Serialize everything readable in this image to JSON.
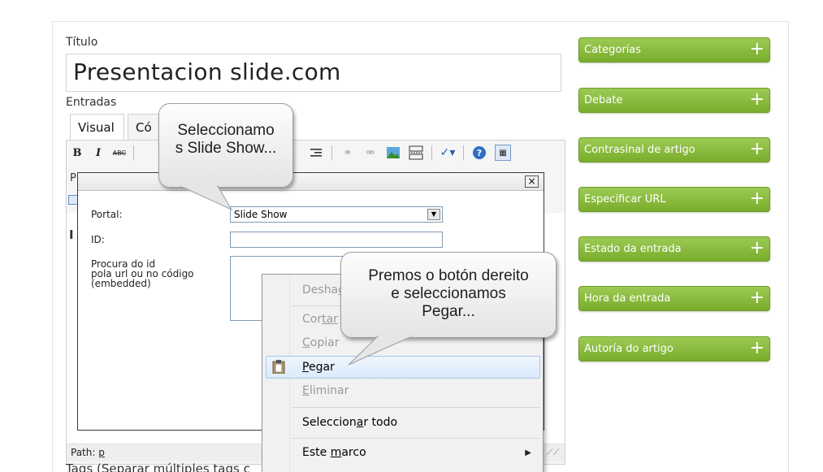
{
  "post": {
    "title_label": "Título",
    "title_value": "Presentacion slide.com",
    "entries_label": "Entradas",
    "tab_visual": "Visual",
    "tab_code": "Có",
    "path_label": "Path:",
    "path_value": "p",
    "tags_label": "Tags (Separar múltiples tags c"
  },
  "toolbar": {
    "bold": "B",
    "italic": "I",
    "strike": "ABC",
    "format_partial": "P"
  },
  "dialog": {
    "portal_label": "Portal:",
    "portal_value": "Slide Show",
    "id_label": "ID:",
    "search_label_line1": "Procura do id",
    "search_label_line2": "pola url ou no código",
    "search_label_line3": "(embedded)",
    "close": "×"
  },
  "context_menu": {
    "undo_prefix": "Desha",
    "undo_rest": "c",
    "cut_prefix": "Cor",
    "cut_rest": "tar",
    "copy_prefix": "C",
    "copy_rest": "opiar",
    "paste_prefix": "P",
    "paste_rest": "egar",
    "delete_prefix": "E",
    "delete_rest": "liminar",
    "select_all_a": "Seleccion",
    "select_all_u": "a",
    "select_all_b": "r todo",
    "frame_a": "Este ",
    "frame_u": "m",
    "frame_b": "arco"
  },
  "callouts": {
    "top_line1": "Seleccionamo",
    "top_line2": "s Slide Show...",
    "right_line1": "Premos o botón dereito",
    "right_line2": "e seleccionamos",
    "right_line3": "Pegar..."
  },
  "sidebar": {
    "items": [
      {
        "label": "Categorías",
        "icon": "+"
      },
      {
        "label": "Debate",
        "icon": "+"
      },
      {
        "label": "Contrasinal de artigo",
        "icon": "+"
      },
      {
        "label": "Especificar URL",
        "icon": "+"
      },
      {
        "label": "Estado da entrada",
        "icon": "+"
      },
      {
        "label": "Hora da entrada",
        "icon": "+"
      },
      {
        "label": "Autoría do artigo",
        "icon": "+"
      }
    ]
  },
  "colors": {
    "sidebar_green": "#86b83a",
    "menu_highlight": "#dbeafb"
  }
}
